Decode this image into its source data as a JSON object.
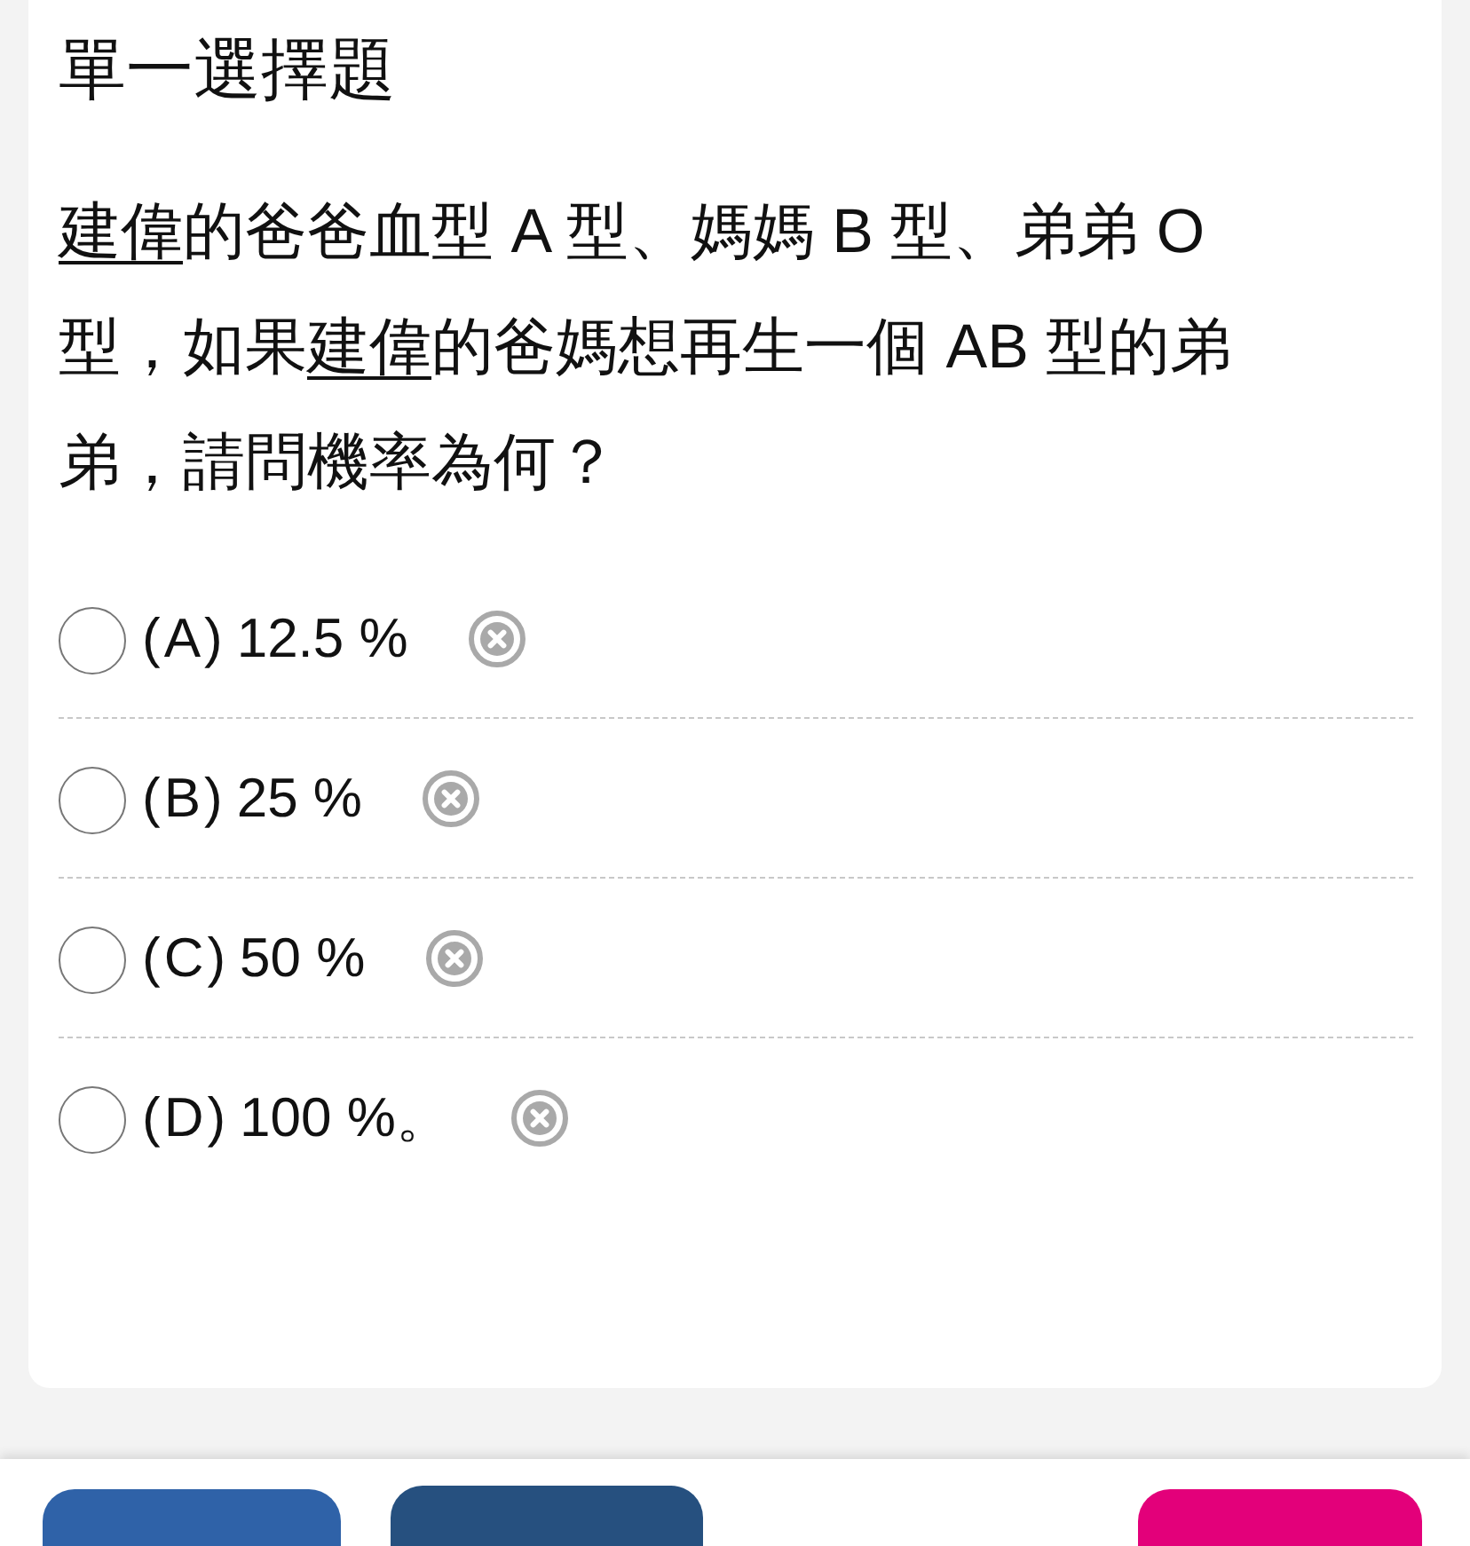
{
  "header": {
    "title": "單一選擇題"
  },
  "question": {
    "segments": [
      {
        "text": "建偉",
        "underline": true
      },
      {
        "text": "的爸爸血型 A 型、媽媽 B 型、弟弟 O 型，如果",
        "underline": false
      },
      {
        "text": "建偉",
        "underline": true
      },
      {
        "text": "的爸媽想再生一個 AB 型的弟弟，請問機率為何？",
        "underline": false
      }
    ]
  },
  "options": [
    {
      "letter": "(A)",
      "text": "12.5 %",
      "selected": false
    },
    {
      "letter": "(B)",
      "text": "25 %",
      "selected": false
    },
    {
      "letter": "(C)",
      "text": "50 %",
      "selected": false
    },
    {
      "letter": "(D)",
      "text": "100 %。",
      "selected": false
    }
  ],
  "footer_buttons": [
    {
      "color": "#2f62a8"
    },
    {
      "color": "#26507f"
    },
    {
      "color": "#e3007a"
    }
  ]
}
